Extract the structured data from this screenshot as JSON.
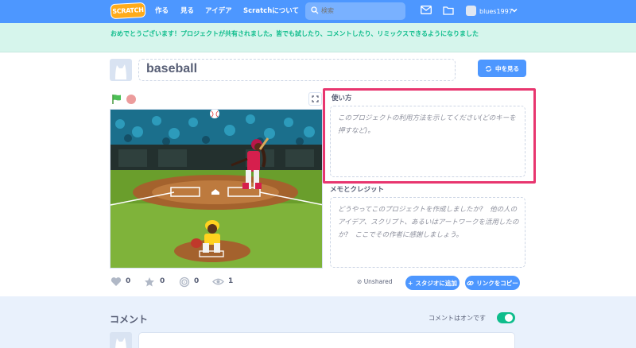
{
  "nav": {
    "logo": "SCRATCH",
    "links": [
      "作る",
      "見る",
      "アイデア",
      "Scratchについて"
    ],
    "search_placeholder": "検索",
    "username": "blues1997"
  },
  "banner": {
    "message": "おめでとうございます！プロジェクトが共有されました。皆でも試したり、コメントしたり、リミックスできるようになりました"
  },
  "project": {
    "title": "baseball",
    "see_inside_label": "中を見る"
  },
  "instructions": {
    "heading": "使い方",
    "placeholder": "このプロジェクトの利用方法を示してください(どのキーを押すなど)。"
  },
  "notes": {
    "heading": "メモとクレジット",
    "placeholder": "どうやってこのプロジェクトを作成しましたか?　他の人のアイデア、スクリプト、あるいはアートワークを活用したのか?　ここでその作者に感謝しましょう。"
  },
  "stats": {
    "loves": "0",
    "favorites": "0",
    "remixes": "0",
    "views": "1"
  },
  "share": {
    "status": "Unshared",
    "add_to_studio": "スタジオに追加",
    "copy_link": "リンクをコピー"
  },
  "comments": {
    "heading": "コメント",
    "status": "コメントはオンです"
  },
  "colors": {
    "nav_blue": "#4d97ff",
    "highlight": "#e8366f",
    "banner_green": "#0fbd8c",
    "toggle_on": "#0fbd8c"
  }
}
